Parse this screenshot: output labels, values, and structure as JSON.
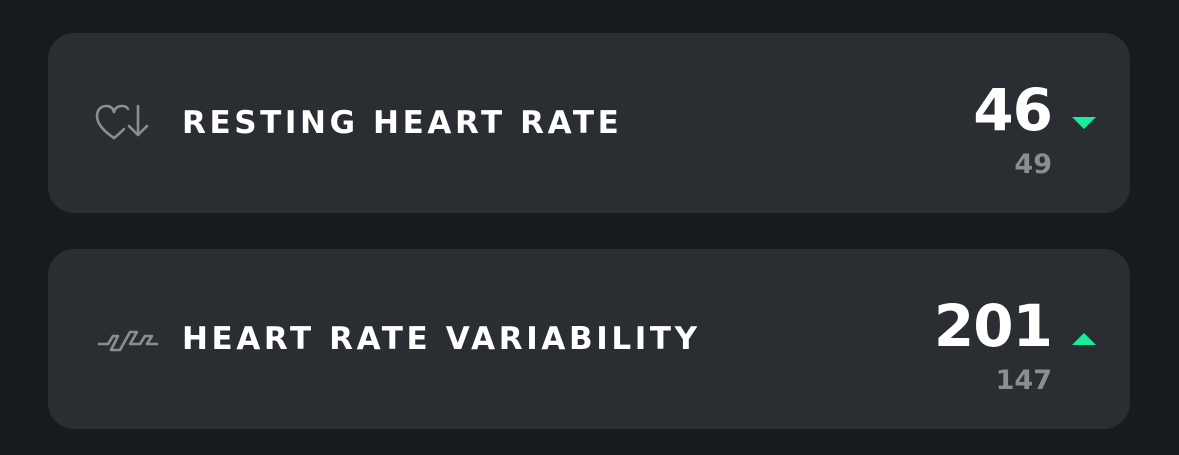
{
  "colors": {
    "background": "#171b1f",
    "card": "#2a2e33",
    "primary_text": "#ffffff",
    "secondary_text": "#8a8e93",
    "trend": "#16ec9b"
  },
  "metrics": [
    {
      "label": "RESTING HEART RATE",
      "icon": "heart-down-arrow-icon",
      "value": "46",
      "baseline": "49",
      "trend": "down",
      "trend_icon": "triangle-down-icon"
    },
    {
      "label": "HEART RATE VARIABILITY",
      "icon": "heart-rate-variability-icon",
      "value": "201",
      "baseline": "147",
      "trend": "up",
      "trend_icon": "triangle-up-icon"
    }
  ]
}
